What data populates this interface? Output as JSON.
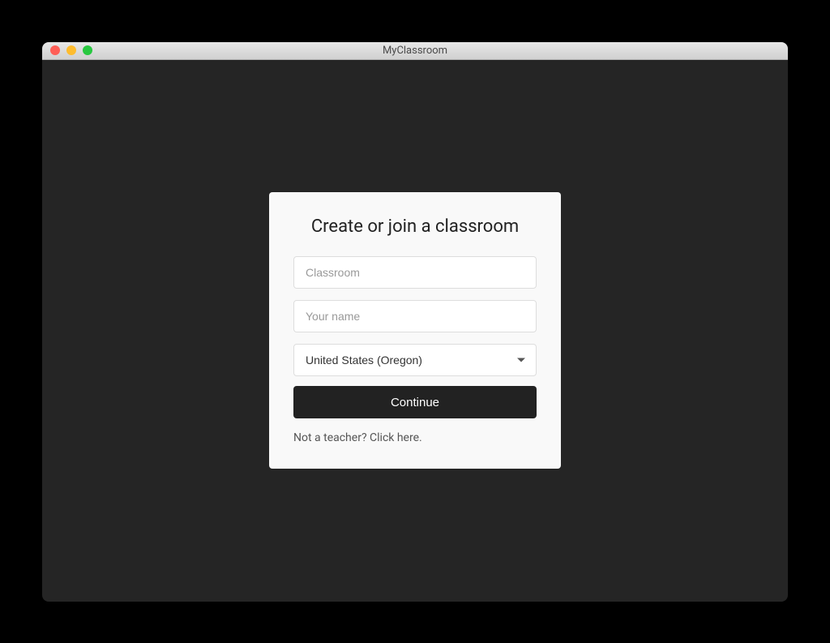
{
  "window": {
    "title": "MyClassroom"
  },
  "card": {
    "title": "Create or join a classroom",
    "classroom_placeholder": "Classroom",
    "name_placeholder": "Your name",
    "region_selected": "United States (Oregon)",
    "continue_label": "Continue",
    "footer_text": "Not a teacher? Click here."
  }
}
